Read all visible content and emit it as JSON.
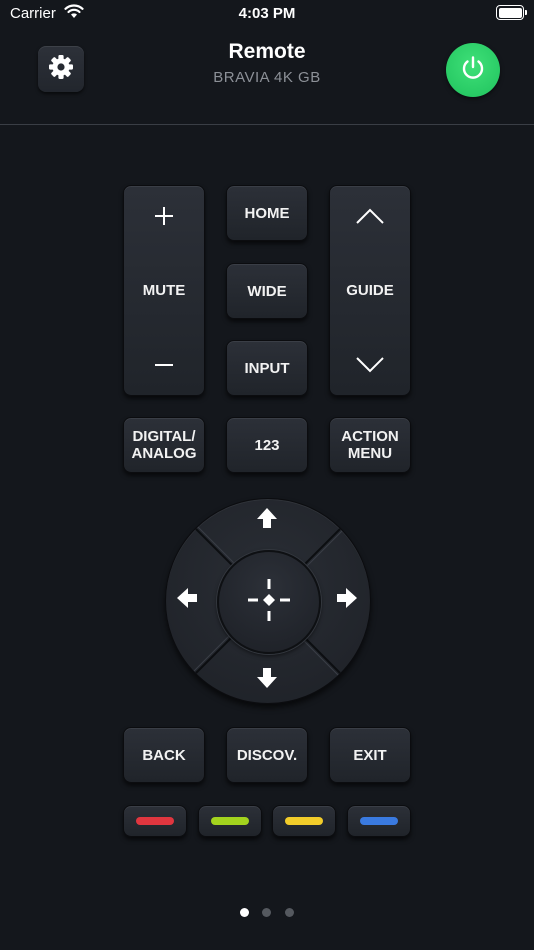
{
  "status_bar": {
    "carrier": "Carrier",
    "time": "4:03 PM"
  },
  "header": {
    "title": "Remote",
    "subtitle": "BRAVIA 4K GB"
  },
  "icons": {
    "settings": "gear-icon",
    "power": "power-icon",
    "wifi": "wifi-icon",
    "battery": "battery-icon",
    "volume_up": "plus-icon",
    "volume_down": "minus-icon",
    "channel_up": "chevron-up-icon",
    "channel_down": "chevron-down-icon",
    "dpad_up": "arrow-up-icon",
    "dpad_down": "arrow-down-icon",
    "dpad_left": "arrow-left-icon",
    "dpad_right": "arrow-right-icon",
    "ok": "crosshair-icon"
  },
  "buttons": {
    "mute": "MUTE",
    "home": "HOME",
    "wide": "WIDE",
    "input": "INPUT",
    "guide": "GUIDE",
    "digital_analog_line1": "DIGITAL/",
    "digital_analog_line2": "ANALOG",
    "numbers": "123",
    "action_menu_line1": "ACTION",
    "action_menu_line2": "MENU",
    "back": "BACK",
    "discover": "DISCOV.",
    "exit": "EXIT"
  },
  "color_buttons": [
    "#e0363f",
    "#a3d31e",
    "#f2cc2a",
    "#3a7ae0"
  ],
  "colors": {
    "background": "#14171c",
    "power_accent": "#2bd46a",
    "subtitle": "#8c9097"
  },
  "pagination": {
    "pages": 3,
    "current": 1
  }
}
